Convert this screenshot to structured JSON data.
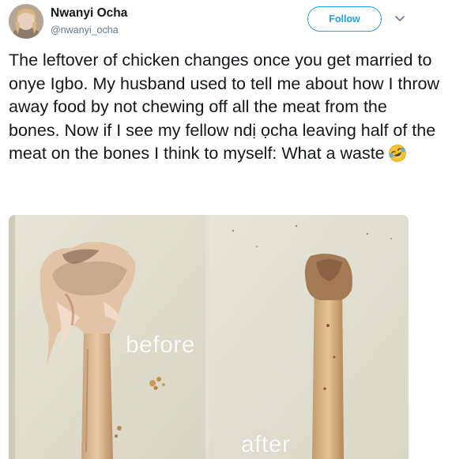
{
  "user": {
    "name": "Nwanyi Ocha",
    "handle": "@nwanyi_ocha",
    "follow_label": "Follow"
  },
  "tweet": {
    "text": "The leftover of chicken changes once you get married to onye Igbo. My husband used to tell me about how I throw away food by not chewing off all the meat from the bones. Now if I see my fellow ndị ọcha leaving half of the meat on the bones I think to myself: What a waste",
    "emoji": "rolling-on-the-floor-laughing-emoji"
  },
  "media": {
    "label_before": "before",
    "label_after": "after"
  },
  "colors": {
    "accent": "#1da1f2",
    "text": "#14171a",
    "secondary": "#657786"
  }
}
